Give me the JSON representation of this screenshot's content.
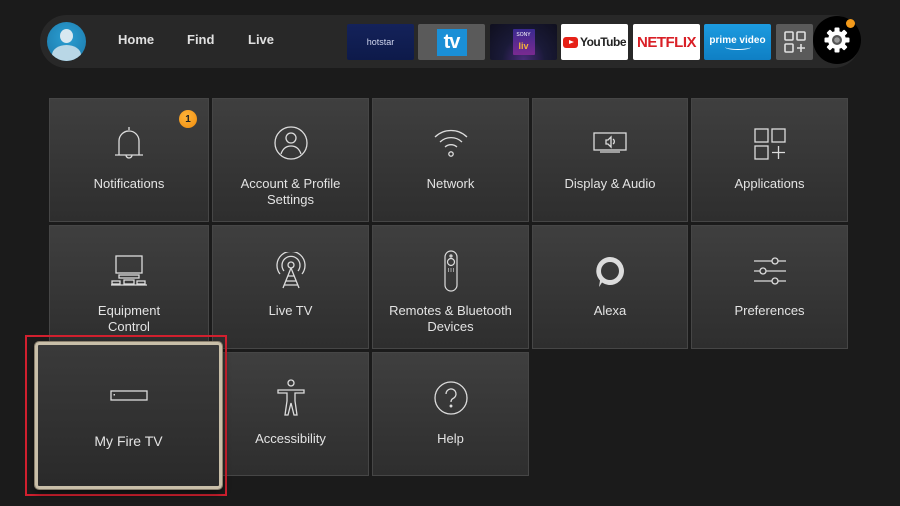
{
  "topbar": {
    "nav": [
      {
        "label": "Home"
      },
      {
        "label": "Find"
      },
      {
        "label": "Live"
      }
    ],
    "apps": [
      {
        "name": "hotstar",
        "label": "hotstar"
      },
      {
        "name": "tv",
        "label": "tv"
      },
      {
        "name": "sonyliv",
        "label": "SONY",
        "sublabel": "liv"
      },
      {
        "name": "youtube",
        "label": "YouTube"
      },
      {
        "name": "netflix",
        "label": "NETFLIX"
      },
      {
        "name": "primevideo",
        "label": "prime video"
      },
      {
        "name": "all-apps",
        "icon": "apps-grid-plus-icon"
      }
    ],
    "settings_icon": "gear-icon",
    "settings_notification": true
  },
  "settings": {
    "tiles": [
      {
        "label": "Notifications",
        "icon": "bell-icon",
        "badge": "1"
      },
      {
        "label": "Account & Profile Settings",
        "icon": "profile-icon"
      },
      {
        "label": "Network",
        "icon": "wifi-icon"
      },
      {
        "label": "Display & Audio",
        "icon": "display-audio-icon"
      },
      {
        "label": "Applications",
        "icon": "applications-icon"
      },
      {
        "label": "Equipment Control",
        "icon": "equipment-icon"
      },
      {
        "label": "Live TV",
        "icon": "antenna-icon"
      },
      {
        "label": "Remotes & Bluetooth Devices",
        "icon": "remote-icon"
      },
      {
        "label": "Alexa",
        "icon": "alexa-icon"
      },
      {
        "label": "Preferences",
        "icon": "sliders-icon"
      },
      {
        "label": "My Fire TV",
        "icon": "fire-tv-device-icon",
        "focused": true
      },
      {
        "label": "Accessibility",
        "icon": "accessibility-icon"
      },
      {
        "label": "Help",
        "icon": "help-icon"
      }
    ]
  },
  "colors": {
    "background": "#1b1b1b",
    "tile": "#3a3a3a",
    "badge": "#f39a1b",
    "highlight": "#d2202f",
    "focus_border": "#c9bfa9"
  }
}
